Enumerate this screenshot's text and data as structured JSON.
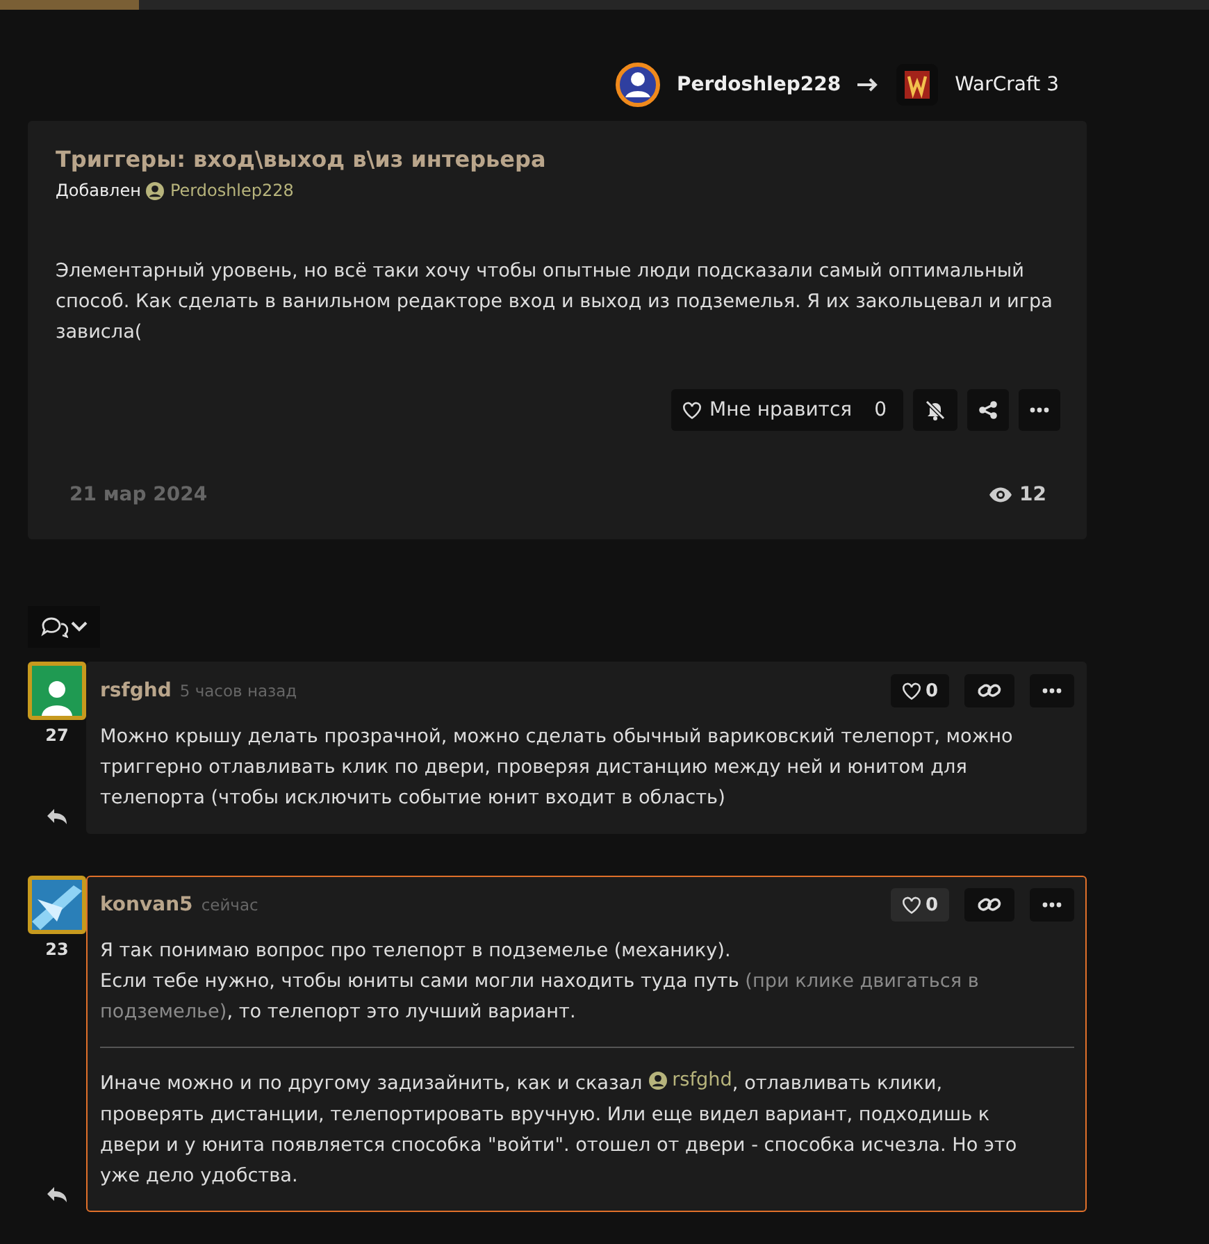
{
  "thread": {
    "author": "Perdoshlep228",
    "game": "WarCraft 3"
  },
  "post": {
    "title": "Триггеры: вход\\выход в\\из интерьера",
    "added_label": "Добавлен",
    "author": "Perdoshlep228",
    "body": "Элементарный уровень, но всё таки хочу чтобы опытные люди подсказали самый оптимальный способ. Как сделать в ванильном редакторе вход и выход из подземелья. Я их закольцевал и игра зависла(",
    "like_label": "Мне нравится",
    "like_count": "0",
    "date": "21 мар 2024",
    "views": "12"
  },
  "comments": [
    {
      "author": "rsfghd",
      "time": "5 часов назад",
      "rank": "27",
      "likes": "0",
      "highlighted": false,
      "kind": "person",
      "sections": [
        [
          [
            {
              "kind": "text",
              "text": "Можно крышу делать прозрачной, можно сделать обычный вариковский телепорт, можно триггерно отлавливать клик по двери, проверяя дистанцию между ней и юнитом для телепорта (чтобы исключить событие юнит входит в область)"
            }
          ]
        ]
      ]
    },
    {
      "author": "konvan5",
      "time": "сейчас",
      "rank": "23",
      "likes": "0",
      "highlighted": true,
      "kind": "picture",
      "sections": [
        [
          [
            {
              "kind": "text",
              "text": "Я так понимаю вопрос про телепорт в подземелье (механику)."
            }
          ],
          [
            {
              "kind": "text",
              "text": "Если тебе нужно, чтобы юниты сами могли находить туда путь "
            },
            {
              "kind": "muted",
              "text": "(при клике двигаться в подземелье)"
            },
            {
              "kind": "text",
              "text": ", то телепорт это лучший вариант."
            }
          ]
        ],
        [
          [
            {
              "kind": "text",
              "text": "Иначе можно и по другому задизайнить, как и сказал "
            },
            {
              "kind": "mention",
              "text": "rsfghd"
            },
            {
              "kind": "text",
              "text": ", отлавливать клики, проверять дистанции, телепортировать вручную. Или еще видел вариант, подходишь к двери и у юнита появляется способка \"войти\". отошел от двери - способка исчезла. Но это уже дело удобства."
            }
          ]
        ]
      ]
    }
  ]
}
